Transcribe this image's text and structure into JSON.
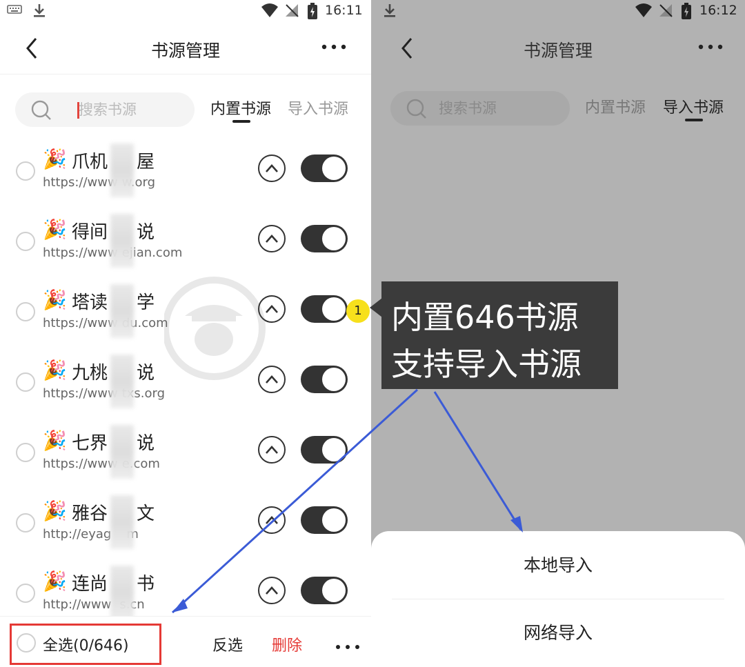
{
  "left_screen": {
    "status": {
      "time": "16:11"
    },
    "header": {
      "title": "书源管理"
    },
    "search": {
      "placeholder": "搜索书源"
    },
    "tabs": [
      {
        "label": "内置书源"
      },
      {
        "label": "导入书源"
      }
    ],
    "sources": [
      {
        "name": "爪机",
        "name_suffix": "屋",
        "url": "https://www",
        "url_suffix": "w.org"
      },
      {
        "name": "得间",
        "name_suffix": "说",
        "url": "https://www",
        "url_suffix": "ejian.com"
      },
      {
        "name": "塔读",
        "name_suffix": "学",
        "url": "https://www",
        "url_suffix": "du.com"
      },
      {
        "name": "九桃",
        "name_suffix": "说",
        "url": "https://www",
        "url_suffix": "txs.org"
      },
      {
        "name": "七界",
        "name_suffix": "说",
        "url": "https://www",
        "url_suffix": "e.com"
      },
      {
        "name": "雅谷",
        "name_suffix": "文",
        "url": "http://eyag",
        "url_suffix": "m"
      },
      {
        "name": "连尚",
        "name_suffix": "书",
        "url": "http://www",
        "url_suffix": "s.cn"
      }
    ],
    "bottom": {
      "select_all": "全选(0/646)",
      "invert": "反选",
      "delete": "删除"
    }
  },
  "right_screen": {
    "status": {
      "time": "16:12"
    },
    "header": {
      "title": "书源管理"
    },
    "search": {
      "placeholder": "搜索书源"
    },
    "tabs": [
      {
        "label": "内置书源"
      },
      {
        "label": "导入书源"
      }
    ],
    "sheet": {
      "options": [
        {
          "label": "本地导入"
        },
        {
          "label": "网络导入"
        }
      ]
    }
  },
  "annotation": {
    "badge": "1",
    "lines": [
      "内置646书源",
      "支持导入书源"
    ]
  },
  "colors": {
    "accent_red": "#e53935",
    "toggle_on": "#333333",
    "arrow_blue": "#3b5bd6",
    "overlay_gray": "#b2b2b2"
  }
}
